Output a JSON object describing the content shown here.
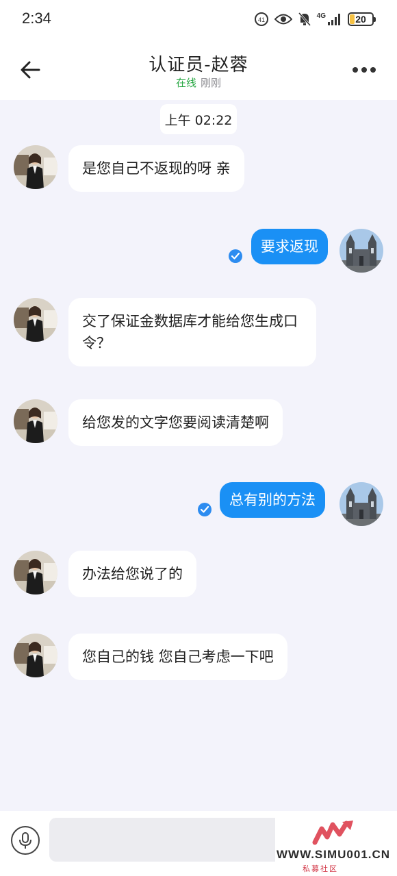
{
  "status": {
    "time": "2:34",
    "network": "4G",
    "battery": "20",
    "battery_level": 0.2
  },
  "header": {
    "title": "认证员-赵蓉",
    "online": "在线",
    "last_seen": "刚刚"
  },
  "chat": {
    "timestamp": "上午 02:22",
    "messages": [
      {
        "side": "in",
        "text": "是您自己不返现的呀 亲"
      },
      {
        "side": "out",
        "text": "要求返现",
        "read": true
      },
      {
        "side": "in",
        "text": "交了保证金数据库才能给您生成口令？"
      },
      {
        "side": "in",
        "text": "给您发的文字您要阅读清楚啊"
      },
      {
        "side": "out",
        "text": "总有别的方法",
        "read": true
      },
      {
        "side": "in",
        "text": "办法给您说了的"
      },
      {
        "side": "in",
        "text": "您自己的钱 您自己考虑一下吧"
      }
    ]
  },
  "input": {
    "value": "",
    "placeholder": ""
  },
  "watermark": {
    "url": "WWW.SIMU001.CN",
    "sub": "私募社区"
  },
  "icons": {
    "back": "arrow-left-icon",
    "more": "more-dots-icon",
    "mic": "microphone-icon",
    "read": "check-circle-icon"
  },
  "colors": {
    "accent": "#1a90f5",
    "online": "#2aa845",
    "background": "#f3f3fb"
  }
}
